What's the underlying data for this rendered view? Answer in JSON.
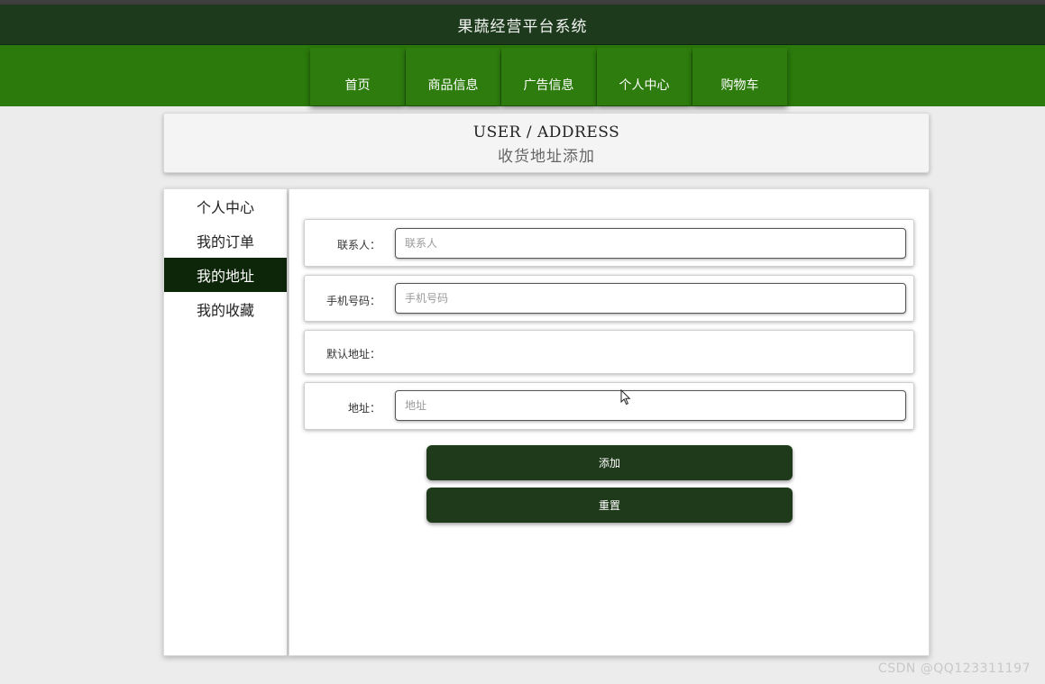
{
  "app": {
    "title": "果蔬经营平台系统"
  },
  "nav": {
    "items": [
      {
        "label": "首页"
      },
      {
        "label": "商品信息"
      },
      {
        "label": "广告信息"
      },
      {
        "label": "个人中心"
      },
      {
        "label": "购物车"
      }
    ]
  },
  "header": {
    "title_en": "USER / ADDRESS",
    "title_zh": "收货地址添加"
  },
  "sidebar": {
    "items": [
      {
        "label": "个人中心",
        "active": false
      },
      {
        "label": "我的订单",
        "active": false
      },
      {
        "label": "我的地址",
        "active": true
      },
      {
        "label": "我的收藏",
        "active": false
      }
    ]
  },
  "form": {
    "contact": {
      "label": "联系人：",
      "placeholder": "联系人",
      "value": ""
    },
    "phone": {
      "label": "手机号码：",
      "placeholder": "手机号码",
      "value": ""
    },
    "default_address": {
      "label": "默认地址："
    },
    "address": {
      "label": "地址：",
      "placeholder": "地址",
      "value": ""
    },
    "add_button": "添加",
    "reset_button": "重置"
  },
  "watermark": "CSDN @QQ123311197",
  "colors": {
    "title_bar": "#1d3b1c",
    "nav_bar": "#2b7a0b",
    "sidebar_active": "#0d2509",
    "button": "#1f3a1b",
    "page_bg": "#ececec"
  },
  "icons": {
    "cursor": "mouse-pointer-icon"
  }
}
